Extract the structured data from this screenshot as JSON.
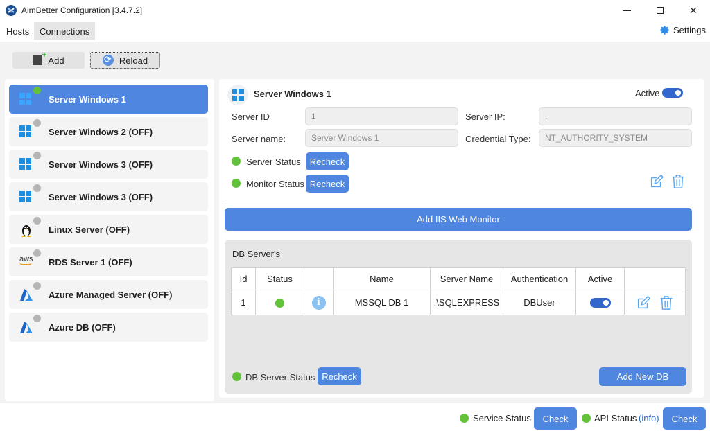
{
  "window": {
    "title": "AimBetter Configuration [3.4.7.2]",
    "close_glyph": "✕"
  },
  "menu": {
    "tabs": [
      {
        "label": "Hosts"
      },
      {
        "label": "Connections"
      }
    ],
    "settings_label": "Settings"
  },
  "toolbar": {
    "add_label": "Add",
    "reload_label": "Reload"
  },
  "hosts": [
    {
      "label": "Server Windows 1",
      "icon": "windows-icon",
      "online": true,
      "selected": true
    },
    {
      "label": "Server Windows 2 (OFF)",
      "icon": "windows-icon",
      "online": false
    },
    {
      "label": "Server Windows 3 (OFF)",
      "icon": "windows-icon",
      "online": false
    },
    {
      "label": "Server Windows 3 (OFF)",
      "icon": "windows-icon",
      "online": false
    },
    {
      "label": "Linux Server (OFF)",
      "icon": "linux-icon",
      "online": false
    },
    {
      "label": "RDS Server 1 (OFF)",
      "icon": "aws-icon",
      "online": false
    },
    {
      "label": "Azure Managed Server (OFF)",
      "icon": "azure-icon",
      "online": false
    },
    {
      "label": "Azure DB (OFF)",
      "icon": "azure-icon",
      "online": false
    }
  ],
  "aws_text": "aws",
  "server": {
    "title": "Server Windows 1",
    "active_label": "Active",
    "active": true,
    "server_id_label": "Server ID",
    "server_id_value": "1",
    "server_ip_label": "Server IP:",
    "server_ip_value": ".",
    "server_name_label": "Server name:",
    "server_name_value": "Server Windows 1",
    "credential_type_label": "Credential Type:",
    "credential_type_value": "NT_AUTHORITY_SYSTEM",
    "server_status_label": "Server Status",
    "monitor_status_label": "Monitor Status",
    "recheck_label": "Recheck",
    "status_color": "#62c33a"
  },
  "add_iis_label": "Add IIS Web Monitor",
  "db_panel": {
    "title": "DB Server's",
    "columns": [
      "Id",
      "Status",
      "",
      "Name",
      "Server Name",
      "Authentication",
      "Active",
      ""
    ],
    "rows": [
      {
        "id": "1",
        "status": "online",
        "info_glyph": "i",
        "name": "MSSQL DB 1",
        "server_name": ".\\SQLEXPRESS",
        "authentication": "DBUser",
        "active": true
      }
    ],
    "db_server_status_label": "DB Server Status",
    "recheck_label": "Recheck",
    "add_new_db_label": "Add New DB"
  },
  "statusbar": {
    "service_status_label": "Service Status",
    "check_label": "Check",
    "api_status_label": "API Status",
    "info_label": "(info)"
  },
  "colors": {
    "accent": "#4f87e0",
    "status_green": "#62c33a",
    "status_off": "#b5b5b5"
  }
}
